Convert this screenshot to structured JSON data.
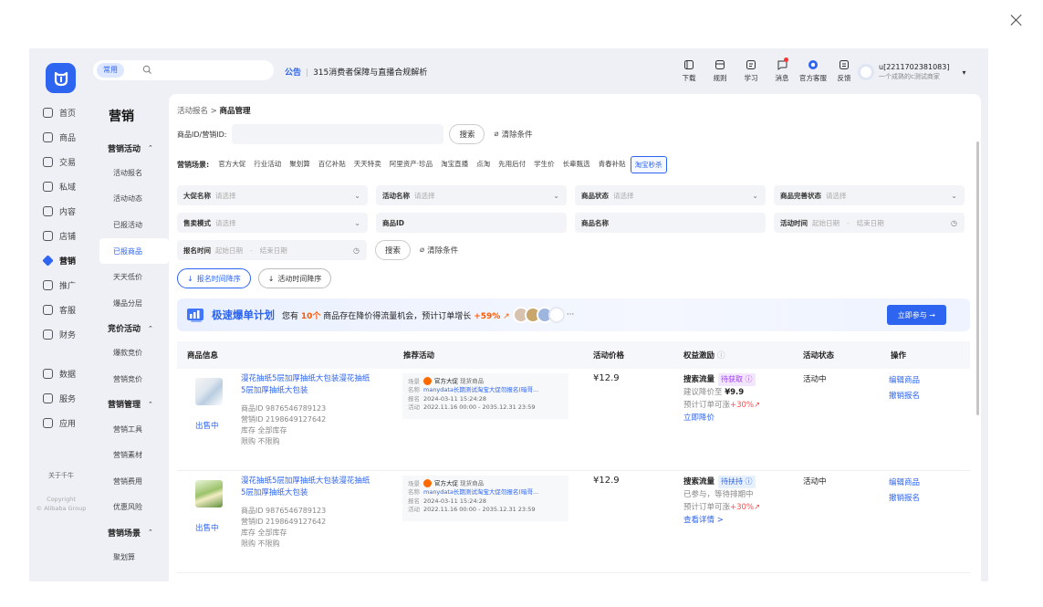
{
  "header": {
    "common_tag": "常用",
    "notice_tag": "公告",
    "notice_text": "315消费者保障与直播合规解析",
    "tools": [
      {
        "label": "下载",
        "icon": "download-icon",
        "dot": false
      },
      {
        "label": "规则",
        "icon": "rules-icon",
        "dot": false
      },
      {
        "label": "学习",
        "icon": "learn-icon",
        "dot": false
      },
      {
        "label": "消息",
        "icon": "message-icon",
        "dot": true
      },
      {
        "label": "官方客服",
        "icon": "service-icon",
        "dot": false
      },
      {
        "label": "反馈",
        "icon": "feedback-icon",
        "dot": false
      }
    ],
    "user": {
      "name": "u[2211702381083]",
      "role": "一个成熟的c测试商家"
    }
  },
  "left_nav": {
    "items": [
      "首页",
      "商品",
      "交易",
      "私域",
      "内容",
      "店铺",
      "营销",
      "推广",
      "客服",
      "财务",
      "数据",
      "服务",
      "应用"
    ],
    "active": "营销",
    "footer": "关于千牛",
    "copyright": [
      "Copyright",
      "© Alibaba Group"
    ]
  },
  "sub_nav": {
    "title": "营销",
    "groups": [
      {
        "label": "营销活动",
        "items": [
          "活动报名",
          "活动动态",
          "已报活动",
          "已报商品",
          "天天低价",
          "爆品分层"
        ]
      },
      {
        "label": "竞价活动",
        "items": [
          "爆款竞价",
          "营销竞价"
        ]
      },
      {
        "label": "营销管理",
        "items": [
          "营销工具",
          "营销素材",
          "营销费用",
          "优惠风险"
        ]
      },
      {
        "label": "营销场景",
        "items": [
          "聚划算"
        ]
      }
    ],
    "active": "已报商品"
  },
  "main": {
    "breadcrumb": {
      "parent": "活动报名",
      "sep": ">",
      "current": "商品管理"
    },
    "id_label": "商品ID/营销ID:",
    "search_btn": "搜索",
    "clear_btn": "清除条件",
    "scene_label": "营销场景:",
    "scenes": [
      "官方大促",
      "行业活动",
      "聚划算",
      "百亿补贴",
      "天天特卖",
      "阿里资产·珍品",
      "淘宝直播",
      "点淘",
      "先用后付",
      "学生价",
      "长辈甄选",
      "青春补贴",
      "淘宝秒杀"
    ],
    "scene_active": "淘宝秒杀",
    "filters_row1": [
      {
        "label": "大促名称",
        "placeholder": "请选择"
      },
      {
        "label": "活动名称",
        "placeholder": "请选择"
      },
      {
        "label": "商品状态",
        "placeholder": "请选择"
      },
      {
        "label": "商品完善状态",
        "placeholder": "请选择"
      }
    ],
    "filters_row2": {
      "sale_mode": {
        "label": "售卖模式",
        "placeholder": "请选择"
      },
      "product_id": "商品ID",
      "product_name": "商品名称",
      "activity_time": {
        "label": "活动时间",
        "start": "起始日期",
        "end": "结束日期"
      }
    },
    "signup_time": {
      "label": "报名时间",
      "start": "起始日期",
      "end": "结束日期"
    },
    "sort_buttons": [
      "报名时间降序",
      "活动时间降序"
    ],
    "banner": {
      "title": "极速爆单计划",
      "text_pre": "您有",
      "count": "10个",
      "text_mid": "商品存在降价得流量机会，预计订单增长",
      "growth": "+59%",
      "more": "···",
      "cta": "立即参与 →"
    },
    "table": {
      "headers": [
        "商品信息",
        "推荐活动",
        "活动价格",
        "权益激励",
        "活动状态",
        "操作"
      ],
      "rows": [
        {
          "title": "漫花抽纸5层加厚抽纸大包装漫花抽纸5层加厚抽纸大包装",
          "status_tag": "出售中",
          "product_id": "商品ID  9876546789123",
          "marketing_id": "营销ID  2198649127642",
          "stock": "库存  全部库存",
          "limit": "限购  不限购",
          "activity": {
            "scene_k": "场景",
            "scene": "官方大促",
            "scene_extra": "现货商品",
            "name_k": "名称",
            "name": "manydata长期测试淘宝大促勿报名(暗哥...",
            "signup_k": "报名",
            "signup": "2024-03-11 15:24:28",
            "time_k": "活动",
            "time": "2022.11.16 00:00 - 2035.12.31 23:59"
          },
          "price": "¥12.9",
          "benefit": {
            "head": "搜索流量",
            "pill": "待获取 ⓘ",
            "pill_type": "p",
            "line2_pre": "建议降价至",
            "line2_val": "¥9.9",
            "line3_pre": "预计订单可涨",
            "line3_val": "+30%↗",
            "link": "立即降价"
          },
          "status": "活动中",
          "ops": [
            "编辑商品",
            "撤销报名"
          ]
        },
        {
          "title": "漫花抽纸5层加厚抽纸大包装漫花抽纸5层加厚抽纸大包装",
          "status_tag": "出售中",
          "product_id": "商品ID  9876546789123",
          "marketing_id": "营销ID  2198649127642",
          "stock": "库存  全部库存",
          "limit": "限购  不限购",
          "activity": {
            "scene_k": "场景",
            "scene": "官方大促",
            "scene_extra": "现货商品",
            "name_k": "名称",
            "name": "manydata长期测试淘宝大促勿报名(暗哥...",
            "signup_k": "报名",
            "signup": "2024-03-11 15:24:28",
            "time_k": "活动",
            "time": "2022.11.16 00:00 - 2035.12.31 23:59"
          },
          "price": "¥12.9",
          "benefit": {
            "head": "搜索流量",
            "pill": "待扶持 ⓘ",
            "pill_type": "g",
            "line2_pre": "已参与，等待排期中",
            "line2_val": "",
            "line3_pre": "预计订单可涨",
            "line3_val": "+30%↗",
            "link": "查看详情 >"
          },
          "status": "活动中",
          "ops": [
            "编辑商品",
            "撤销报名"
          ]
        }
      ]
    }
  }
}
